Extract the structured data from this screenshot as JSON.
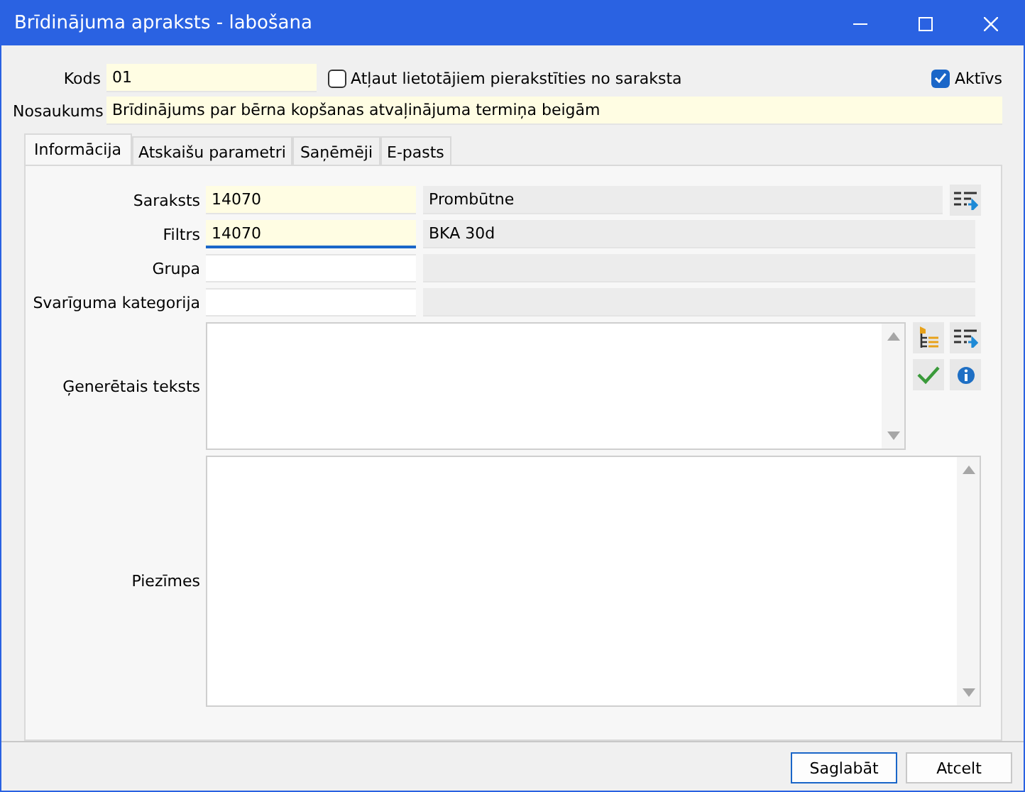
{
  "window": {
    "title": "Brīdinājuma apraksts - labošana",
    "controls": [
      {
        "kind": "minimize"
      },
      {
        "kind": "maximize"
      },
      {
        "kind": "close"
      }
    ]
  },
  "header": {
    "code_label": "Kods",
    "code_value": "01",
    "allow_unsubscribe": {
      "label": "Atļaut lietotājiem pierakstīties no saraksta",
      "checked": false
    },
    "active": {
      "label": "Aktīvs",
      "checked": true
    },
    "name_label": "Nosaukums",
    "name_value": "Brīdinājums par bērna kopšanas atvaļinājuma termiņa beigām"
  },
  "tabs": [
    {
      "label": "Informācija",
      "selected": true
    },
    {
      "label": "Atskaišu parametri",
      "selected": false
    },
    {
      "label": "Saņēmēji",
      "selected": false
    },
    {
      "label": "E-pasts",
      "selected": false
    }
  ],
  "fields": [
    {
      "label": "Saraksts",
      "code": "14070",
      "description": "Prombūtne",
      "focused": false,
      "has_button": true
    },
    {
      "label": "Filtrs",
      "code": "14070",
      "description": "BKA 30d",
      "focused": true,
      "has_button": false
    },
    {
      "label": "Grupa",
      "focused": false,
      "has_button": false
    },
    {
      "label": "Svarīguma kategorija",
      "focused": false,
      "has_button": false
    }
  ],
  "generated_text": {
    "label": "Ģenerētais teksts"
  },
  "notes": {
    "label": "Piezīmes"
  },
  "buttons": [
    {
      "label": "Saglabāt",
      "default": true
    },
    {
      "label": "Atcelt",
      "default": false
    }
  ]
}
